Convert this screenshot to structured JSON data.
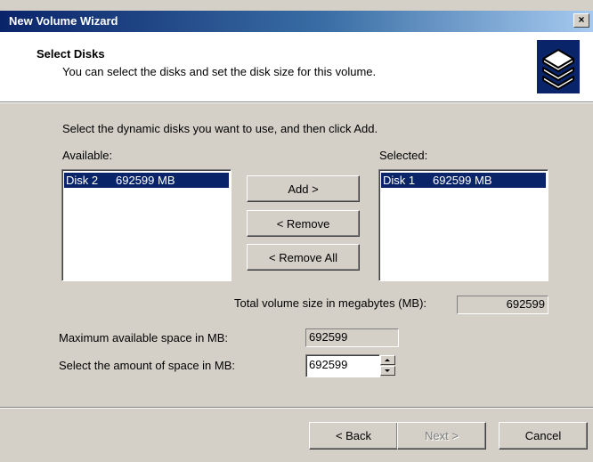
{
  "window": {
    "title": "New Volume Wizard",
    "close_glyph": "×"
  },
  "header": {
    "title": "Select Disks",
    "subtitle": "You can select the disks and set the disk size for this volume.",
    "icon": "wizard-disks-icon"
  },
  "instructions": "Select the dynamic disks you want to use, and then click Add.",
  "available": {
    "label": "Available:",
    "items": [
      {
        "name": "Disk 2",
        "size": "692599 MB"
      }
    ]
  },
  "selected": {
    "label": "Selected:",
    "items": [
      {
        "name": "Disk 1",
        "size": "692599 MB"
      }
    ]
  },
  "buttons": {
    "add": "Add >",
    "remove": "< Remove",
    "remove_all": "< Remove All",
    "back": "< Back",
    "next": "Next >",
    "cancel": "Cancel"
  },
  "total": {
    "label": "Total volume size in megabytes (MB):",
    "value": "692599"
  },
  "max_space": {
    "label": "Maximum available space in MB:",
    "value": "692599"
  },
  "amount": {
    "label": "Select the amount of space in MB:",
    "value": "692599"
  },
  "colors": {
    "selection": "#0a246a",
    "face": "#d4d0c8",
    "title_start": "#0a246a"
  }
}
